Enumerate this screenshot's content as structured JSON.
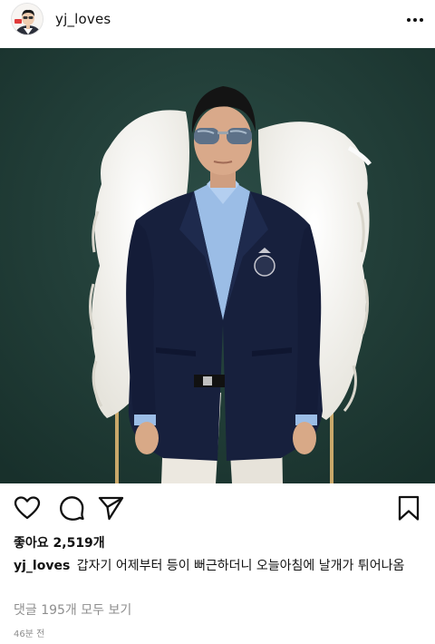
{
  "post": {
    "username": "yj_loves",
    "likes_text": "좋아요 2,519개",
    "caption_username": "yj_loves",
    "caption_text": "갑자기 어제부터 등이 뻐근하더니 오늘아침에 날개가 튀어나옴",
    "comments_link": "댓글 195개 모두 보기",
    "timestamp": "46분 전"
  },
  "icons": {
    "more": "more-horizontal-icon",
    "like": "heart-icon",
    "comment": "comment-bubble-icon",
    "share": "paper-plane-icon",
    "save": "bookmark-icon"
  },
  "colors": {
    "background": "#ffffff",
    "text": "#111111",
    "muted": "#8e8e8e",
    "photo_wall": "#1f3d37"
  }
}
